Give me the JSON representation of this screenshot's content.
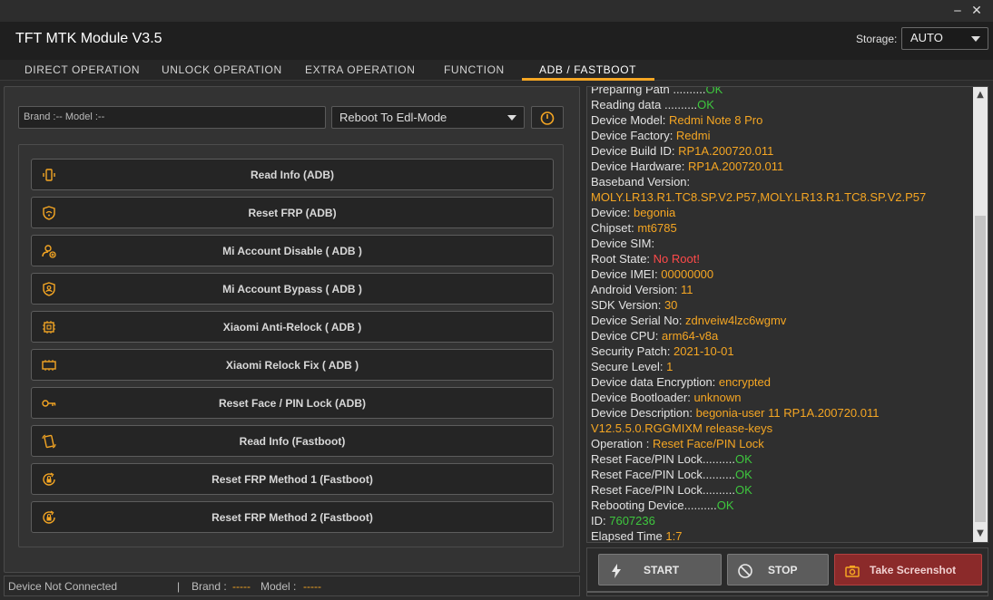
{
  "window": {
    "minimize_label": "‒",
    "close_label": "✕"
  },
  "header": {
    "title": "TFT MTK Module V3.5",
    "storage_label": "Storage:",
    "storage_value": "AUTO"
  },
  "tabs": [
    {
      "label": "DIRECT OPERATION",
      "active": false
    },
    {
      "label": "UNLOCK OPERATION",
      "active": false
    },
    {
      "label": "EXTRA OPERATION",
      "active": false
    },
    {
      "label": "FUNCTION",
      "active": false
    },
    {
      "label": "ADB / FASTBOOT",
      "active": true
    }
  ],
  "device_bar": {
    "brand_model_text": "Brand :--  Model :--",
    "reboot_option": "Reboot To Edl-Mode"
  },
  "operations": [
    {
      "label": "Read Info (ADB)",
      "icon": "phone-vibrate-icon"
    },
    {
      "label": "Reset FRP (ADB)",
      "icon": "shield-wifi-icon"
    },
    {
      "label": "Mi Account Disable ( ADB )",
      "icon": "user-add-icon"
    },
    {
      "label": "Mi Account Bypass ( ADB )",
      "icon": "shield-user-icon"
    },
    {
      "label": "Xiaomi Anti-Relock ( ADB )",
      "icon": "chip-icon"
    },
    {
      "label": "Xiaomi Relock Fix ( ADB )",
      "icon": "memory-icon"
    },
    {
      "label": "Reset Face / PIN Lock (ADB)",
      "icon": "key-icon"
    },
    {
      "label": "Read Info (Fastboot)",
      "icon": "phone-rotate-icon"
    },
    {
      "label": "Reset FRP Method 1 (Fastboot)",
      "icon": "lock-refresh-icon"
    },
    {
      "label": "Reset FRP Method 2 (Fastboot)",
      "icon": "lock-refresh-icon"
    }
  ],
  "status_bar": {
    "connection": "Device Not Connected",
    "separator": "|",
    "brand_label": "Brand :",
    "brand_value": "-----",
    "model_label": "Model :",
    "model_value": "-----"
  },
  "log": [
    {
      "label": "Preparing Path ..........",
      "value": "OK",
      "kind": "ok"
    },
    {
      "label": "Reading data ..........",
      "value": "OK",
      "kind": "ok"
    },
    {
      "label": "Device Model: ",
      "value": "Redmi Note 8 Pro",
      "kind": "val"
    },
    {
      "label": "Device Factory: ",
      "value": "Redmi",
      "kind": "val"
    },
    {
      "label": "Device Build ID: ",
      "value": "RP1A.200720.011",
      "kind": "val"
    },
    {
      "label": "Device Hardware: ",
      "value": "RP1A.200720.011",
      "kind": "val"
    },
    {
      "label": "Baseband Version:",
      "value": "",
      "kind": "val"
    },
    {
      "label": "",
      "value": "MOLY.LR13.R1.TC8.SP.V2.P57,MOLY.LR13.R1.TC8.SP.V2.P57",
      "kind": "val"
    },
    {
      "label": "Device: ",
      "value": "begonia",
      "kind": "val"
    },
    {
      "label": "Chipset: ",
      "value": "mt6785",
      "kind": "val"
    },
    {
      "label": "Device SIM:",
      "value": "",
      "kind": "val"
    },
    {
      "label": "Root State:  ",
      "value": "No Root!",
      "kind": "red"
    },
    {
      "label": "Device IMEI: ",
      "value": "00000000",
      "kind": "val"
    },
    {
      "label": "Android Version: ",
      "value": "11",
      "kind": "val"
    },
    {
      "label": "SDK Version: ",
      "value": "30",
      "kind": "val"
    },
    {
      "label": "Device Serial No: ",
      "value": "zdnveiw4lzc6wgmv",
      "kind": "val"
    },
    {
      "label": "Device CPU: ",
      "value": "arm64-v8a",
      "kind": "val"
    },
    {
      "label": "Security Patch: ",
      "value": "2021-10-01",
      "kind": "val"
    },
    {
      "label": "Secure Level: ",
      "value": "1",
      "kind": "val"
    },
    {
      "label": "Device data Encryption: ",
      "value": "encrypted",
      "kind": "val"
    },
    {
      "label": "Device Bootloader: ",
      "value": "unknown",
      "kind": "val"
    },
    {
      "label": "Device Description: ",
      "value": "begonia-user 11 RP1A.200720.011",
      "kind": "val"
    },
    {
      "label": "",
      "value": "V12.5.5.0.RGGMIXM release-keys",
      "kind": "val"
    },
    {
      "label": "Operation : ",
      "value": "Reset Face/PIN Lock",
      "kind": "val"
    },
    {
      "label": "Reset Face/PIN Lock..........",
      "value": "OK",
      "kind": "ok"
    },
    {
      "label": "Reset Face/PIN Lock..........",
      "value": "OK",
      "kind": "ok"
    },
    {
      "label": "Reset Face/PIN Lock..........",
      "value": "OK",
      "kind": "ok"
    },
    {
      "label": "Rebooting Device..........",
      "value": "OK",
      "kind": "ok"
    },
    {
      "label": "ID: ",
      "value": "7607236",
      "kind": "ok"
    },
    {
      "label": "Elapsed Time ",
      "value": "1:7",
      "kind": "val"
    }
  ],
  "actions": {
    "start_label": "START",
    "stop_label": "STOP",
    "screenshot_label": "Take Screenshot"
  },
  "colors": {
    "accent": "#f5a623",
    "ok": "#3ec73e",
    "error": "#ff4a4a",
    "screenshot_button": "#8b2a2a"
  }
}
